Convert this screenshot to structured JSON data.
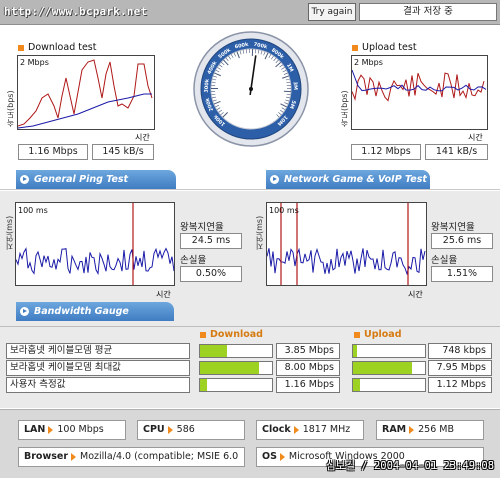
{
  "topbar": {
    "url": "http://www.bcpark.net",
    "try_again_label": "Try again",
    "save_result_label": "결과 저장 중"
  },
  "download_test": {
    "title": "Download test",
    "y_axis": "속도(bps)",
    "y_max_label": "2 Mbps",
    "x_axis": "시간",
    "speed_mbps": "1.16 Mbps",
    "speed_kbs": "145 kB/s"
  },
  "upload_test": {
    "title": "Upload test",
    "y_axis": "속도(bps)",
    "y_max_label": "2 Mbps",
    "x_axis": "시간",
    "speed_mbps": "1.12 Mbps",
    "speed_kbs": "141 kB/s"
  },
  "speedometer": {
    "tick_labels": [
      "100k",
      "200k",
      "300k",
      "400k",
      "500k",
      "600k",
      "700k",
      "800k",
      "1M",
      "3M",
      "5M",
      "10M"
    ],
    "needle_fraction": 0.53
  },
  "sections": {
    "general_ping": "General Ping Test",
    "network_game": "Network Game & VoIP Test",
    "bandwidth_gauge": "Bandwidth Gauge"
  },
  "ping_general": {
    "y_axis": "지연(ms)",
    "y_max_label": "100 ms",
    "x_axis": "시간",
    "rtt_label": "왕복지연율",
    "rtt_value": "24.5 ms",
    "loss_label": "손실율",
    "loss_value": "0.50%"
  },
  "ping_game": {
    "y_axis": "지연(ms)",
    "y_max_label": "100 ms",
    "x_axis": "시간",
    "rtt_label": "왕복지연율",
    "rtt_value": "25.6 ms",
    "loss_label": "손실율",
    "loss_value": "1.51%"
  },
  "bandwidth": {
    "download_head": "Download",
    "upload_head": "Upload",
    "rows": [
      {
        "label": "보라홈넷 케이블모뎀 평균",
        "download": "3.85 Mbps",
        "download_fraction": 0.38,
        "upload": "748 kbps",
        "upload_fraction": 0.06
      },
      {
        "label": "보라홈넷 케이블모뎀 최대값",
        "download": "8.00 Mbps",
        "download_fraction": 0.82,
        "upload": "7.95 Mbps",
        "upload_fraction": 0.82
      },
      {
        "label": "사용자 측정값",
        "download": "1.16 Mbps",
        "download_fraction": 0.1,
        "upload": "1.12 Mbps",
        "upload_fraction": 0.1
      }
    ]
  },
  "system": {
    "lan_key": "LAN",
    "lan_value": "100 Mbps",
    "cpu_key": "CPU",
    "cpu_value": "586",
    "clock_key": "Clock",
    "clock_value": "1817 MHz",
    "ram_key": "RAM",
    "ram_value": "256 MB",
    "browser_key": "Browser",
    "browser_value": "Mozilla/4.0 (compatible; MSIE 6.0",
    "os_key": "OS",
    "os_value": "Microsoft Windows 2000"
  },
  "signature": "심보길 / 2004-04-01 23:49:08",
  "colors": {
    "accent_orange": "#f08a1c",
    "section_blue": "#3f7cc2",
    "bar_green": "#9dd122",
    "trace_red": "#b01818",
    "trace_blue": "#1a1aa8"
  }
}
